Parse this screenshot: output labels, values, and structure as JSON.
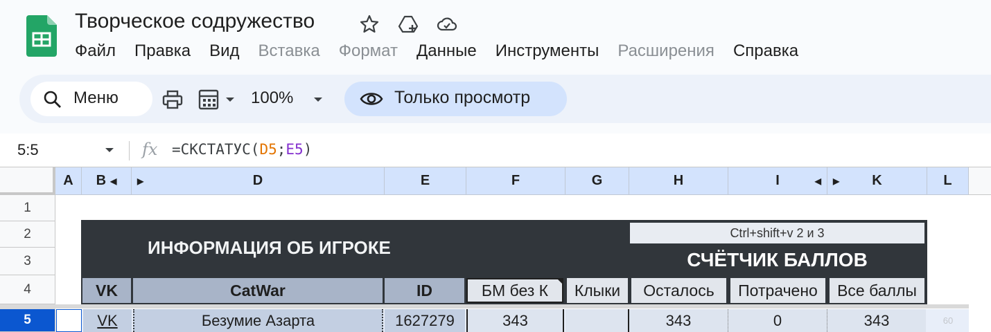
{
  "header": {
    "title": "Творческое содружество",
    "menu": [
      {
        "label": "Файл",
        "enabled": true
      },
      {
        "label": "Правка",
        "enabled": true
      },
      {
        "label": "Вид",
        "enabled": true
      },
      {
        "label": "Вставка",
        "enabled": false
      },
      {
        "label": "Формат",
        "enabled": false
      },
      {
        "label": "Данные",
        "enabled": true
      },
      {
        "label": "Инструменты",
        "enabled": true
      },
      {
        "label": "Расширения",
        "enabled": false
      },
      {
        "label": "Справка",
        "enabled": true
      }
    ],
    "icons": [
      "star-icon",
      "move-to-drive-icon",
      "cloud-status-icon"
    ]
  },
  "toolbar": {
    "search_label": "Меню",
    "zoom": "100%",
    "view_only_label": "Только просмотр",
    "icons": [
      "search-icon",
      "print-icon",
      "format-calculator-icon",
      "dropdown-icon",
      "eye-icon"
    ]
  },
  "formula_bar": {
    "name_box": "5:5",
    "fx": "fx",
    "formula_prefix": "=СКСТАТУС(",
    "arg1": "D5",
    "sep": ";",
    "arg2": "E5",
    "formula_suffix": ")"
  },
  "columns": [
    "A",
    "B",
    "D",
    "E",
    "F",
    "G",
    "H",
    "I",
    "K",
    "L"
  ],
  "rows": [
    "1",
    "2",
    "3",
    "4",
    "5"
  ],
  "sheet": {
    "info_title": "ИНФОРМАЦИЯ ОБ ИГРОКЕ",
    "shortcut_note": "Ctrl+shift+v 2 и 3",
    "counter_title": "СЧЁТЧИК БАЛЛОВ",
    "subheaders": [
      "VK",
      "CatWar",
      "ID",
      "БМ без К",
      "Клыки",
      "Осталось",
      "Потрачено",
      "Все баллы"
    ],
    "row5": {
      "vk": "VK",
      "catwar": "Безумие Азарта",
      "id": "1627279",
      "bm": "343",
      "fangs": "",
      "left": "343",
      "spent": "0",
      "total": "343",
      "l": "60"
    }
  },
  "colors": {
    "accent": "#0b57d0",
    "header_selected": "#d3e3fd",
    "dark_block": "#31363b",
    "formula_arg1": "#e37400",
    "formula_arg2": "#8430ce"
  }
}
